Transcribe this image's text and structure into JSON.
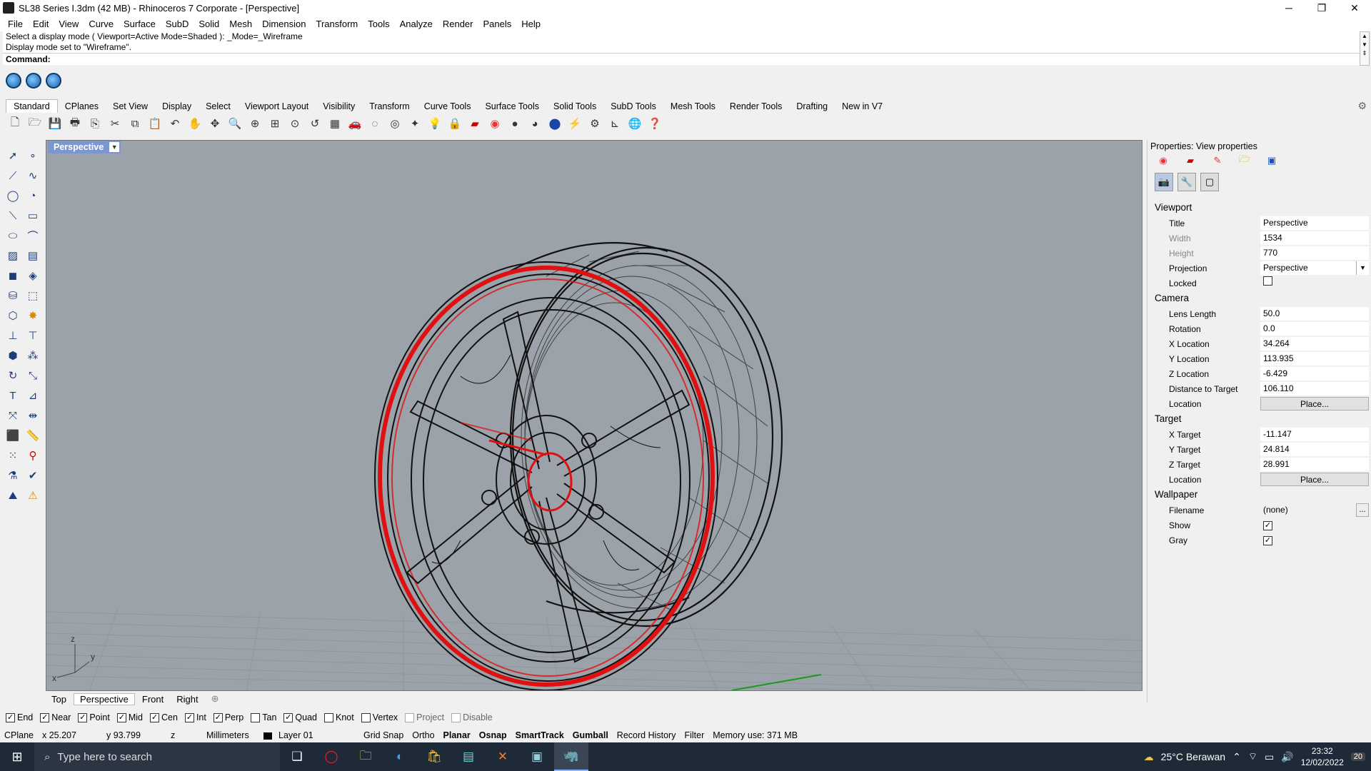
{
  "window": {
    "title": "SL38 Series I.3dm (42 MB) - Rhinoceros 7 Corporate - [Perspective]",
    "min": "─",
    "max": "❐",
    "close": "✕"
  },
  "menu": [
    "File",
    "Edit",
    "View",
    "Curve",
    "Surface",
    "SubD",
    "Solid",
    "Mesh",
    "Dimension",
    "Transform",
    "Tools",
    "Analyze",
    "Render",
    "Panels",
    "Help"
  ],
  "command": {
    "history_1": "Select a display mode ( Viewport=Active  Mode=Shaded ): _Mode=_Wireframe",
    "history_2": "Display mode set to \"Wireframe\".",
    "prompt": "Command:"
  },
  "toolbar_tabs": [
    "Standard",
    "CPlanes",
    "Set View",
    "Display",
    "Select",
    "Viewport Layout",
    "Visibility",
    "Transform",
    "Curve Tools",
    "Surface Tools",
    "Solid Tools",
    "SubD Tools",
    "Mesh Tools",
    "Render Tools",
    "Drafting",
    "New in V7"
  ],
  "viewport": {
    "label": "Perspective",
    "axis_z": "z",
    "axis_y": "y",
    "axis_x": "x"
  },
  "view_tabs": [
    "Top",
    "Perspective",
    "Front",
    "Right"
  ],
  "view_tab_add": "⊕",
  "properties": {
    "title": "Properties: View properties",
    "viewport_section": "Viewport",
    "title_label": "Title",
    "title_value": "Perspective",
    "width_label": "Width",
    "width_value": "1534",
    "height_label": "Height",
    "height_value": "770",
    "projection_label": "Projection",
    "projection_value": "Perspective",
    "locked_label": "Locked",
    "camera_section": "Camera",
    "lens_label": "Lens Length",
    "lens_value": "50.0",
    "rotation_label": "Rotation",
    "rotation_value": "0.0",
    "xloc_label": "X Location",
    "xloc_value": "34.264",
    "yloc_label": "Y Location",
    "yloc_value": "113.935",
    "zloc_label": "Z Location",
    "zloc_value": "-6.429",
    "dist_label": "Distance to Target",
    "dist_value": "106.110",
    "location_label": "Location",
    "place_label": "Place...",
    "target_section": "Target",
    "xt_label": "X Target",
    "xt_value": "-11.147",
    "yt_label": "Y Target",
    "yt_value": "24.814",
    "zt_label": "Z Target",
    "zt_value": "28.991",
    "tlocation_label": "Location",
    "tplace_label": "Place...",
    "wallpaper_section": "Wallpaper",
    "filename_label": "Filename",
    "filename_value": "(none)",
    "filename_dots": "...",
    "show_label": "Show",
    "gray_label": "Gray"
  },
  "osnap": [
    {
      "label": "End",
      "checked": true
    },
    {
      "label": "Near",
      "checked": true
    },
    {
      "label": "Point",
      "checked": true
    },
    {
      "label": "Mid",
      "checked": true
    },
    {
      "label": "Cen",
      "checked": true
    },
    {
      "label": "Int",
      "checked": true
    },
    {
      "label": "Perp",
      "checked": true
    },
    {
      "label": "Tan",
      "checked": false
    },
    {
      "label": "Quad",
      "checked": true
    },
    {
      "label": "Knot",
      "checked": false
    },
    {
      "label": "Vertex",
      "checked": false
    },
    {
      "label": "Project",
      "checked": false
    },
    {
      "label": "Disable",
      "checked": false
    }
  ],
  "status": {
    "cplane": "CPlane",
    "x": "x 25.207",
    "y": "y 93.799",
    "z": "z",
    "units": "Millimeters",
    "layer": "Layer 01",
    "grid_snap": "Grid Snap",
    "ortho": "Ortho",
    "planar": "Planar",
    "osnap": "Osnap",
    "smarttrack": "SmartTrack",
    "gumball": "Gumball",
    "record_history": "Record History",
    "filter": "Filter",
    "memory": "Memory use: 371 MB"
  },
  "taskbar": {
    "search_placeholder": "Type here to search",
    "weather": "25°C  Berawan",
    "time": "23:32",
    "date": "12/02/2022",
    "notifications": "20"
  },
  "colors": {
    "viewport_bg": "#9ba2aa",
    "highlight_red": "#e01010",
    "viewport_label_bg": "#7c97d0"
  }
}
